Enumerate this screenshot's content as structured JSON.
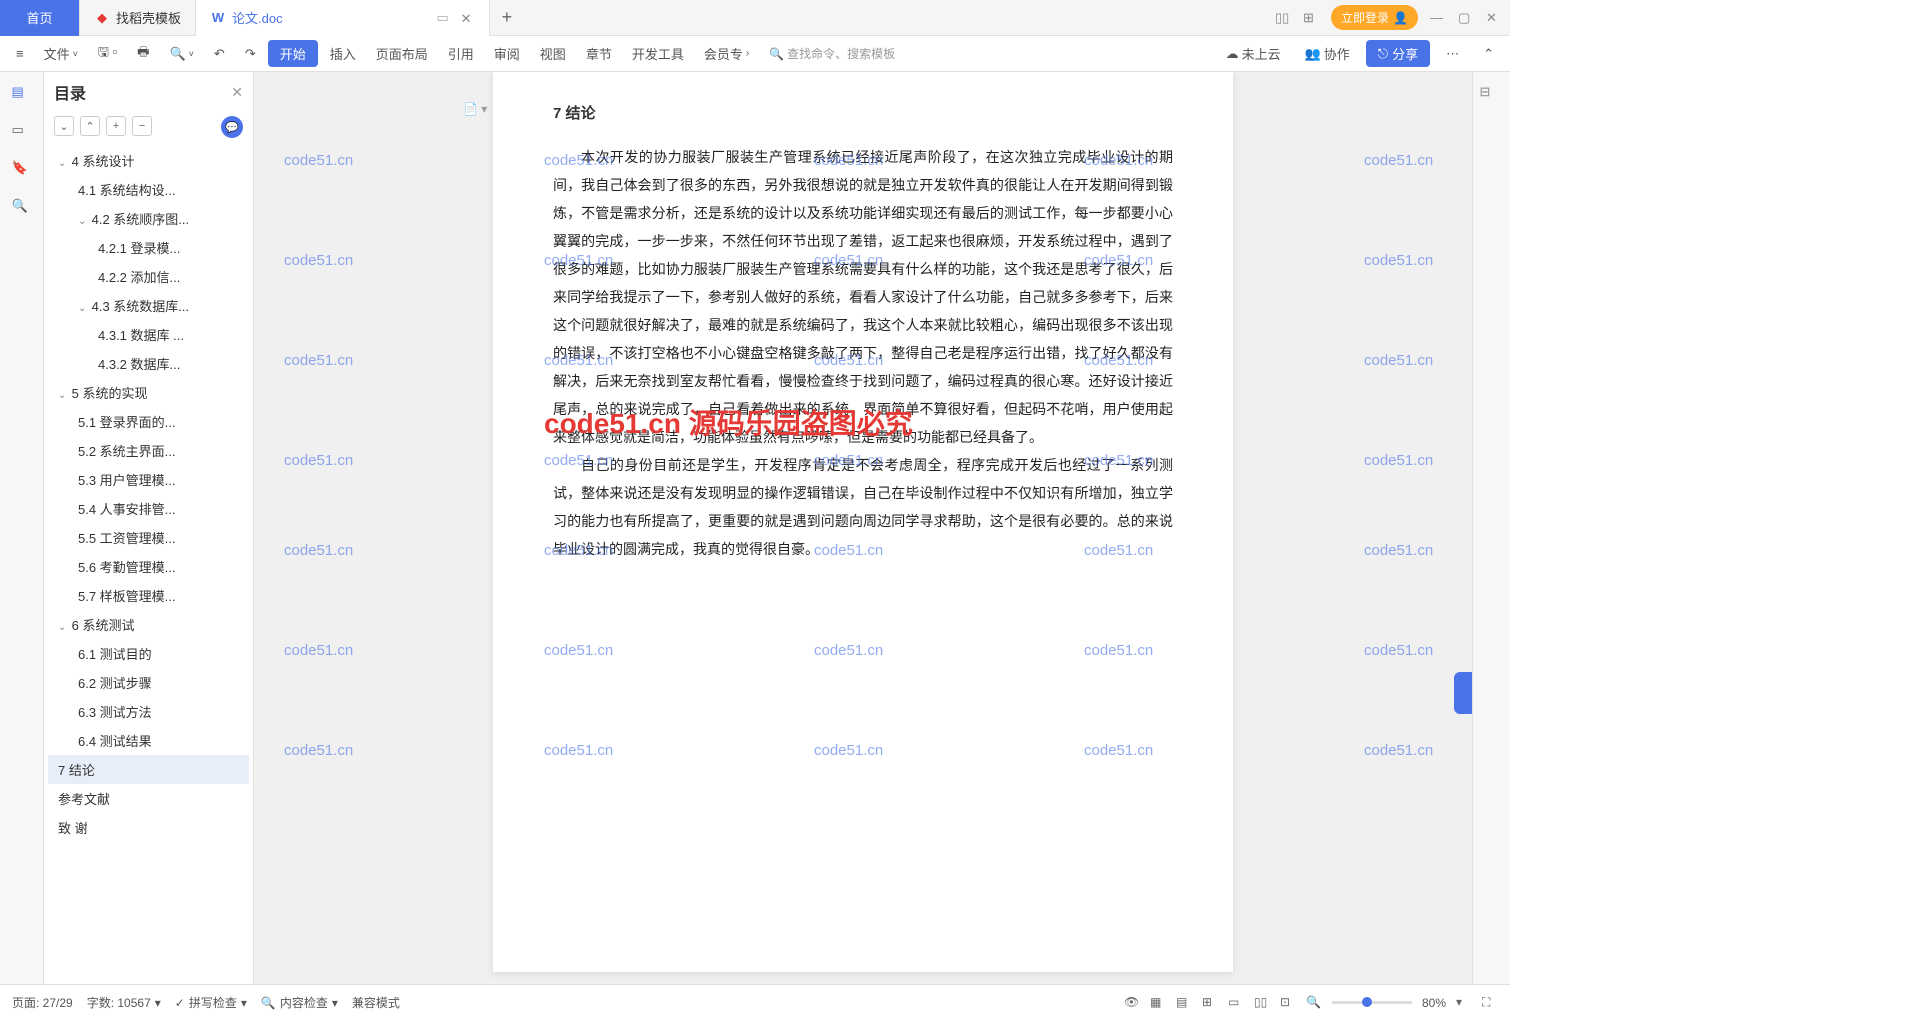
{
  "tabs": {
    "home": "首页",
    "t1": "找稻壳模板",
    "t2": "论文.doc"
  },
  "login": "立即登录",
  "ribbon": {
    "file": "文件",
    "start": "开始",
    "insert": "插入",
    "layout": "页面布局",
    "ref": "引用",
    "review": "审阅",
    "view": "视图",
    "chapter": "章节",
    "dev": "开发工具",
    "member": "会员专",
    "search": "查找命令、搜索模板",
    "cloud": "未上云",
    "collab": "协作",
    "share": "分享"
  },
  "outline": {
    "title": "目录"
  },
  "toc": [
    {
      "lv": 1,
      "t": "4  系统设计",
      "c": 1
    },
    {
      "lv": 2,
      "t": "4.1  系统结构设..."
    },
    {
      "lv": 2,
      "t": "4.2  系统顺序图...",
      "c": 1
    },
    {
      "lv": 3,
      "t": "4.2.1 登录模..."
    },
    {
      "lv": 3,
      "t": "4.2.2 添加信..."
    },
    {
      "lv": 2,
      "t": "4.3  系统数据库...",
      "c": 1
    },
    {
      "lv": 3,
      "t": "4.3.1  数据库 ..."
    },
    {
      "lv": 3,
      "t": "4.3.2  数据库..."
    },
    {
      "lv": 1,
      "t": "5   系统的实现",
      "c": 1
    },
    {
      "lv": 2,
      "t": "5.1  登录界面的..."
    },
    {
      "lv": 2,
      "t": "5.2  系统主界面..."
    },
    {
      "lv": 2,
      "t": "5.3  用户管理模..."
    },
    {
      "lv": 2,
      "t": "5.4   人事安排管..."
    },
    {
      "lv": 2,
      "t": "5.5  工资管理模..."
    },
    {
      "lv": 2,
      "t": "5.6  考勤管理模..."
    },
    {
      "lv": 2,
      "t": "5.7  样板管理模..."
    },
    {
      "lv": 1,
      "t": "6   系统测试",
      "c": 1
    },
    {
      "lv": 2,
      "t": "6.1 测试目的"
    },
    {
      "lv": 2,
      "t": "6.2 测试步骤"
    },
    {
      "lv": 2,
      "t": "6.3 测试方法"
    },
    {
      "lv": 2,
      "t": "6.4 测试结果"
    },
    {
      "lv": 1,
      "t": "7  结论",
      "active": 1
    },
    {
      "lv": 1,
      "t": "参考文献"
    },
    {
      "lv": 1,
      "t": "致   谢"
    }
  ],
  "doc": {
    "heading": "7  结论",
    "p1": "本次开发的协力服装厂服装生产管理系统已经接近尾声阶段了，在这次独立完成毕业设计的期间，我自己体会到了很多的东西，另外我很想说的就是独立开发软件真的很能让人在开发期间得到锻炼，不管是需求分析，还是系统的设计以及系统功能详细实现还有最后的测试工作，每一步都要小心翼翼的完成，一步一步来，不然任何环节出现了差错，返工起来也很麻烦，开发系统过程中，遇到了很多的难题，比如协力服装厂服装生产管理系统需要具有什么样的功能，这个我还是思考了很久，后来同学给我提示了一下，参考别人做好的系统，看看人家设计了什么功能，自己就多多参考下，后来这个问题就很好解决了，最难的就是系统编码了，我这个人本来就比较粗心，编码出现很多不该出现的错误，不该打空格也不小心键盘空格键多敲了两下，整得自己老是程序运行出错，找了好久都没有解决，后来无奈找到室友帮忙看看，慢慢检查终于找到问题了，编码过程真的很心寒。还好设计接近尾声，总的来说完成了，自己看着做出来的系统，界面简单不算很好看，但起码不花哨，用户使用起来整体感觉就是简洁，功能体验虽然有点啰嗦，但是需要的功能都已经具备了。",
    "p2": "自己的身份目前还是学生，开发程序肯定是不会考虑周全，程序完成开发后也经过了一系列测试，整体来说还是没有发现明显的操作逻辑错误，自己在毕设制作过程中不仅知识有所增加，独立学习的能力也有所提高了，更重要的就是遇到问题向周边同学寻求帮助，这个是很有必要的。总的来说毕业设计的圆满完成，我真的觉得很自豪。"
  },
  "watermark": "code51.cn",
  "watermark_red": "code51.cn 源码乐园盗图必究",
  "status": {
    "page": "页面: 27/29",
    "words": "字数: 10567",
    "spell": "拼写检查",
    "content": "内容检查",
    "compat": "兼容模式",
    "zoom": "80%"
  }
}
